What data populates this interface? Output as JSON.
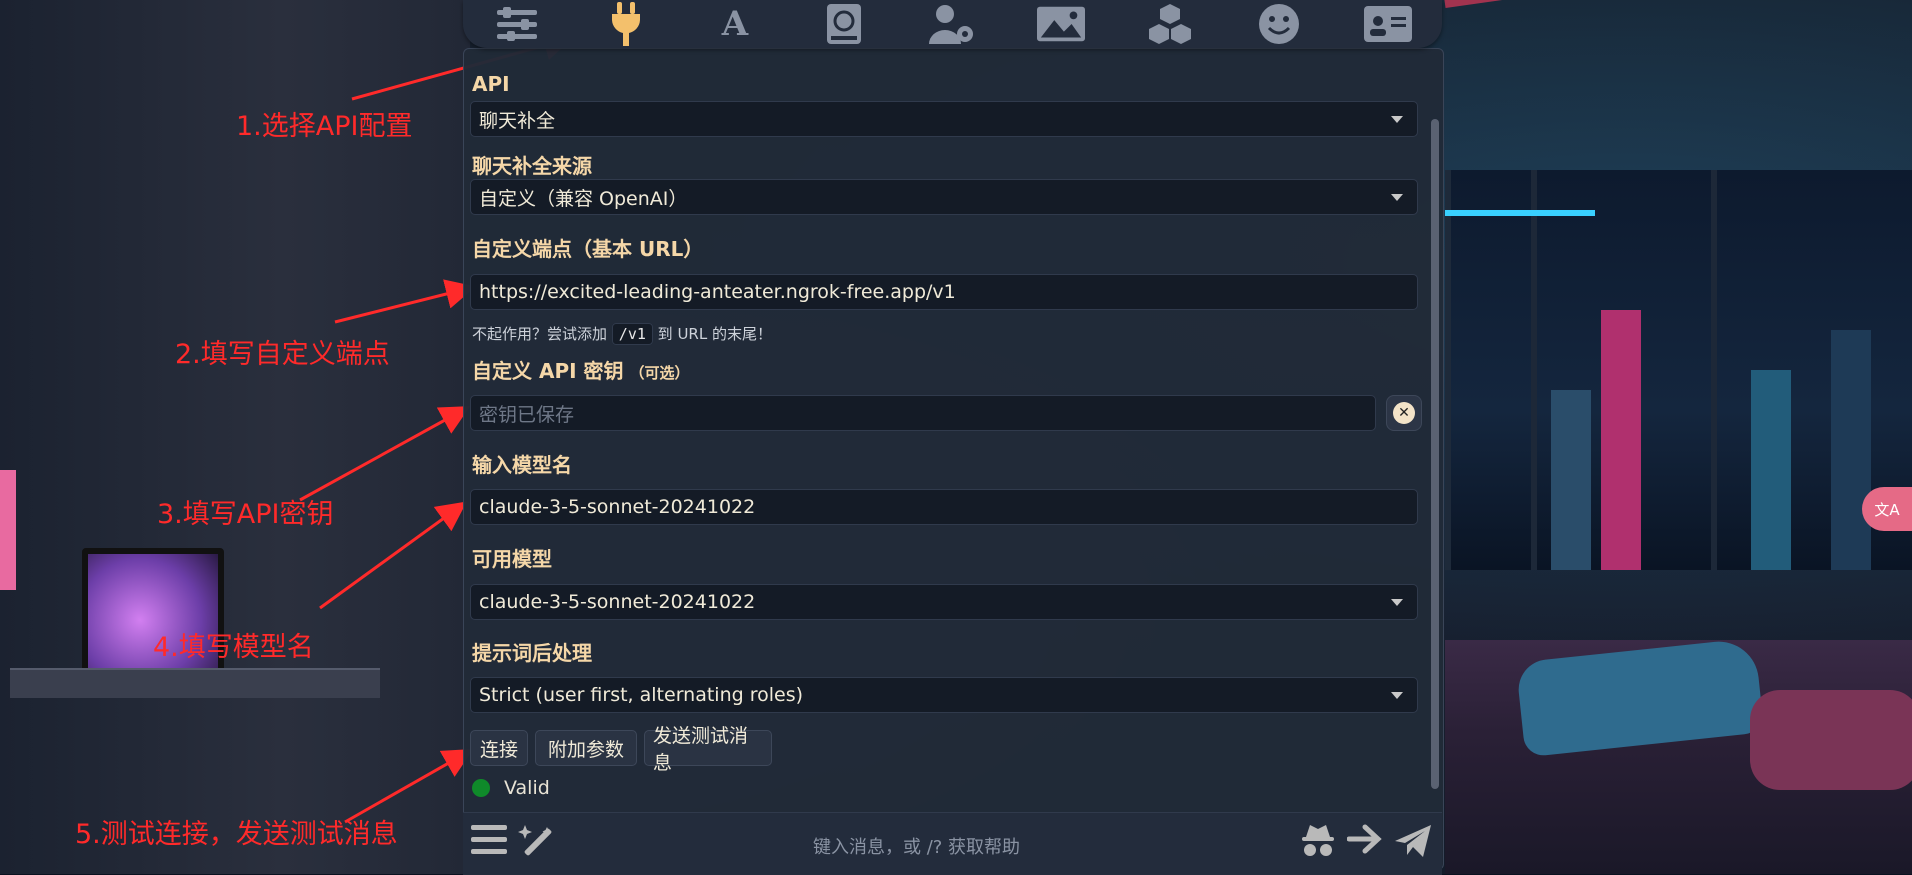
{
  "nav": {
    "items": [
      {
        "name": "sliders-icon",
        "glyph": "☰"
      },
      {
        "name": "plug-icon",
        "glyph": "⏚"
      },
      {
        "name": "font-icon",
        "glyph": "A"
      },
      {
        "name": "book-globe-icon",
        "glyph": "📕"
      },
      {
        "name": "user-gear-icon",
        "glyph": "👤"
      },
      {
        "name": "image-icon",
        "glyph": "🖼"
      },
      {
        "name": "cubes-icon",
        "glyph": "▦"
      },
      {
        "name": "smile-icon",
        "glyph": "☺"
      },
      {
        "name": "id-card-icon",
        "glyph": "🪪"
      }
    ]
  },
  "form": {
    "api_label": "API",
    "api_value": "聊天补全",
    "source_label": "聊天补全来源",
    "source_value": "自定义（兼容 OpenAI）",
    "endpoint_label": "自定义端点（基本 URL）",
    "endpoint_value": "https://excited-leading-anteater.ngrok-free.app/v1",
    "hint_before": "不起作用？尝试添加",
    "hint_code": "/v1",
    "hint_after": "到 URL 的末尾！",
    "key_label": "自定义 API 密钥",
    "key_optional": "（可选）",
    "key_placeholder": "密钥已保存",
    "model_input_label": "输入模型名",
    "model_input_value": "claude-3-5-sonnet-20241022",
    "available_label": "可用模型",
    "available_value": "claude-3-5-sonnet-20241022",
    "postproc_label": "提示词后处理",
    "postproc_value": "Strict (user first, alternating roles)",
    "connect_button": "连接",
    "extra_params_button": "附加参数",
    "test_message_button": "发送测试消息",
    "status_text": "Valid"
  },
  "bottom": {
    "placeholder": "键入消息，或 /? 获取帮助"
  },
  "annotations": {
    "step1": "1.选择API配置",
    "step2": "2.填写自定义端点",
    "step3": "3.填写API密钥",
    "step4": "4.填写模型名",
    "step5": "5.测试连接，发送测试消息"
  },
  "colors": {
    "accent": "#f3c06c",
    "label": "#f5d7a8",
    "annotation": "#ff2a2a",
    "status_ok": "#0f8a2a"
  }
}
